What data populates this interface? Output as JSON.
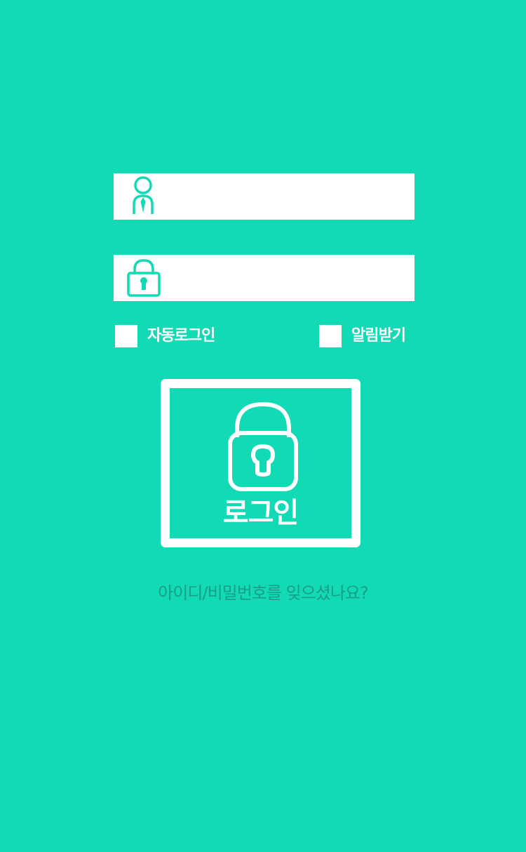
{
  "colors": {
    "background": "#11dab5",
    "field": "#ffffff",
    "icon": "#11dab5",
    "forgot_link": "#1a9e86"
  },
  "id_field": {
    "icon": "user-icon",
    "placeholder": "",
    "value": ""
  },
  "password_field": {
    "icon": "lock-icon",
    "placeholder": "",
    "value": ""
  },
  "options": {
    "auto_login_label": "자동로그인",
    "notifications_label": "알림받기"
  },
  "login_button": {
    "icon": "lock-icon",
    "label": "로그인"
  },
  "forgot_link": "아이디/비밀번호를 잊으셨나요?"
}
